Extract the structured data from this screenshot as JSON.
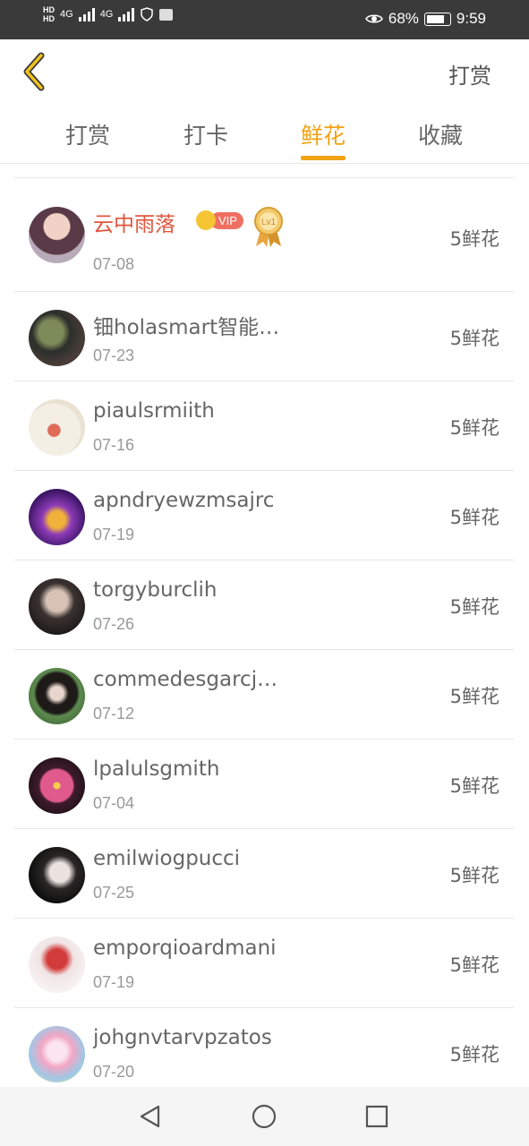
{
  "status_bar": {
    "network_left": "HD",
    "network_left2": "HD",
    "signal1": "4G",
    "signal2": "4G",
    "battery_percent": "68%",
    "time": "9:59",
    "icons": [
      "eye-icon",
      "battery-icon",
      "shield-icon",
      "notification-icon"
    ]
  },
  "header": {
    "back_icon": "chevron-left-icon",
    "action_label": "打赏"
  },
  "tabs": [
    {
      "label": "打赏",
      "active": false
    },
    {
      "label": "打卡",
      "active": false
    },
    {
      "label": "鲜花",
      "active": true
    },
    {
      "label": "收藏",
      "active": false
    }
  ],
  "list": [
    {
      "name": "云中雨落",
      "date": "07-08",
      "count": "5鲜花",
      "vip": "VIP",
      "badge": "Lv1"
    },
    {
      "name": "钿holasmart智能…",
      "date": "07-23",
      "count": "5鲜花"
    },
    {
      "name": "piaulsrmiith",
      "date": "07-16",
      "count": "5鲜花"
    },
    {
      "name": "apndryewzmsajrc",
      "date": "07-19",
      "count": "5鲜花"
    },
    {
      "name": "torgyburclih",
      "date": "07-26",
      "count": "5鲜花"
    },
    {
      "name": "commedesgarcjg…",
      "date": "07-12",
      "count": "5鲜花"
    },
    {
      "name": "lpalulsgmith",
      "date": "07-04",
      "count": "5鲜花"
    },
    {
      "name": "emilwiogpucci",
      "date": "07-25",
      "count": "5鲜花"
    },
    {
      "name": "emporqioardmani",
      "date": "07-19",
      "count": "5鲜花"
    },
    {
      "name": "johgnvtarvpzatos",
      "date": "07-20",
      "count": "5鲜花"
    }
  ],
  "nav_bar": {
    "back": "triangle-back-icon",
    "home": "circle-home-icon",
    "recents": "square-recents-icon"
  },
  "colors": {
    "accent": "#f0a316",
    "vip_name": "#e2553d",
    "text": "#666666",
    "muted": "#999999"
  }
}
